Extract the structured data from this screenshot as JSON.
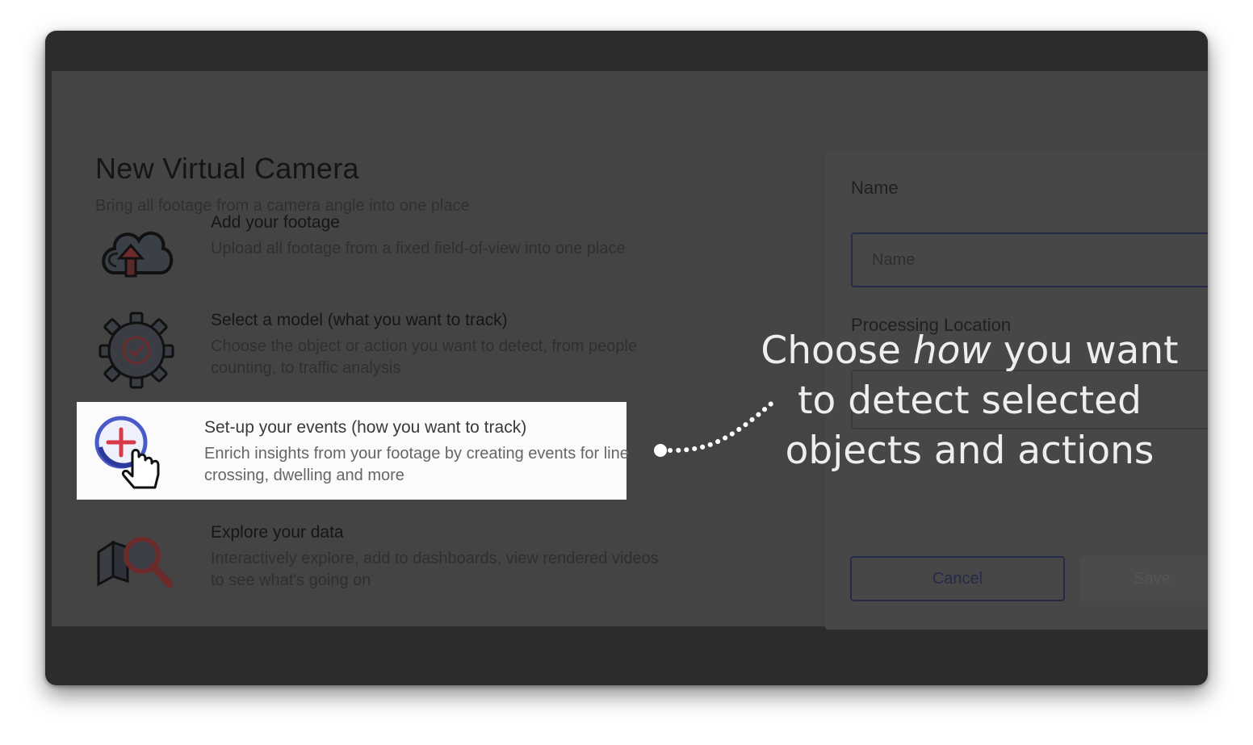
{
  "page": {
    "title": "New Virtual Camera",
    "subtitle": "Bring all footage from a camera angle into one place"
  },
  "steps": [
    {
      "title": "Add your footage",
      "description": "Upload all footage from a fixed field-of-view into one place",
      "icon": "cloud-upload-icon"
    },
    {
      "title": "Select a model (what you want to track)",
      "description": "Choose the object or action you want to detect, from people counting, to traffic analysis",
      "icon": "gear-check-icon"
    },
    {
      "title": "Set-up your events (how you want to track)",
      "description": "Enrich insights from your footage by creating events for line crossing, dwelling and more",
      "icon": "add-click-icon"
    },
    {
      "title": "Explore your data",
      "description": "Interactively explore, add to dashboards, view rendered videos to see what's going on",
      "icon": "magnifier-icon"
    }
  ],
  "form": {
    "name_label": "Name",
    "name_placeholder": "Name",
    "location_label": "Processing Location",
    "cancel_label": "Cancel",
    "save_label": "Save"
  },
  "callout": {
    "before": "Choose ",
    "emphasis": "how",
    "after": " you want to detect selected objects and actions"
  },
  "colors": {
    "overlay": "#444444",
    "highlight_bg": "#fbfbfb",
    "accent_red": "#d63a46",
    "accent_blue": "#4a5ac8",
    "button_border": "#262a4a",
    "callout_text": "#eeeeee"
  }
}
